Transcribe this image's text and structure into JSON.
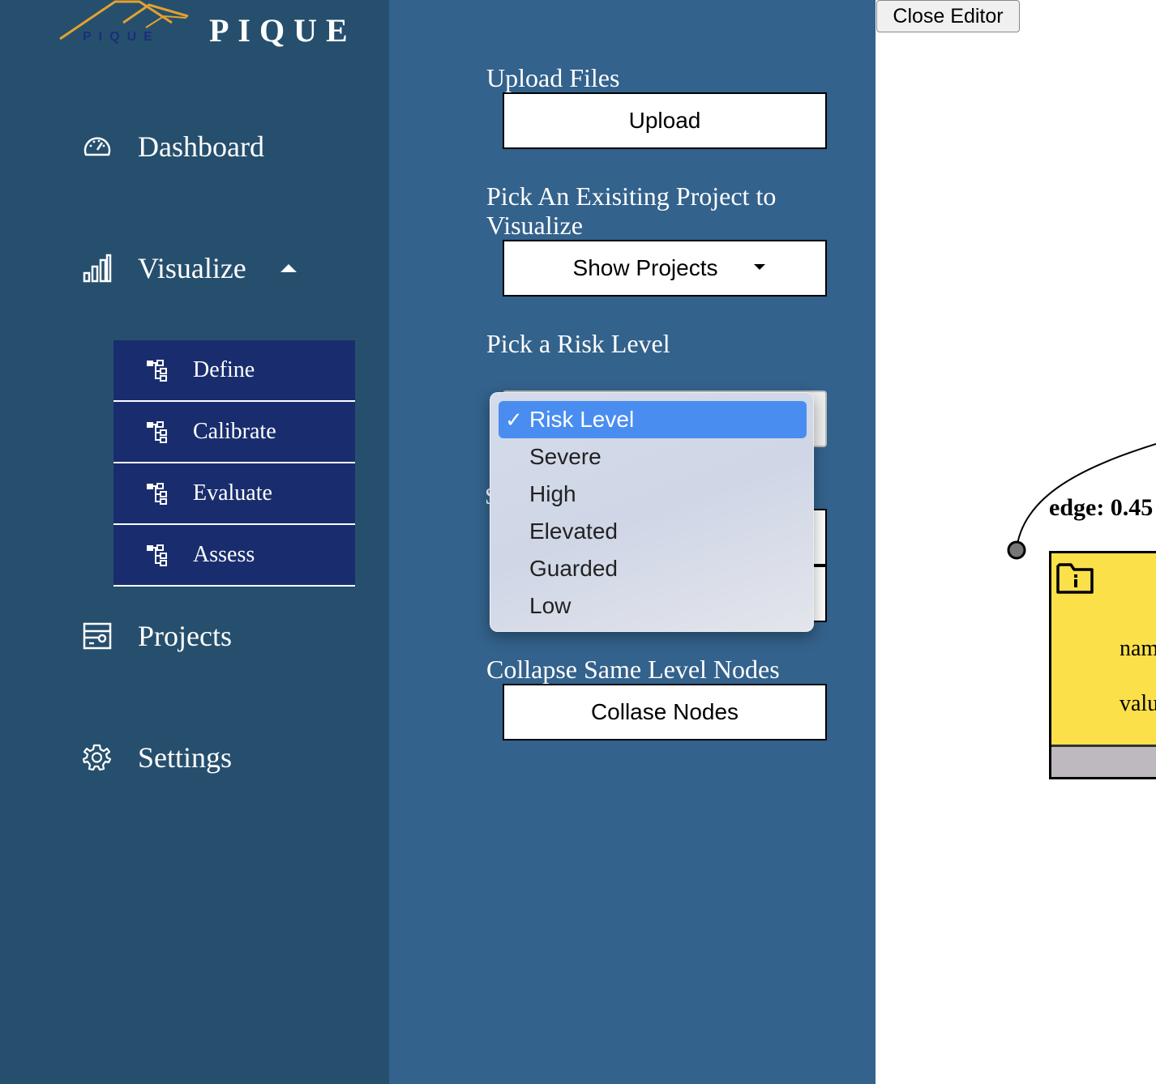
{
  "brand": {
    "name": "PIQUE",
    "logo_text": "PIQUE"
  },
  "sidebar": {
    "items": [
      {
        "label": "Dashboard",
        "icon": "gauge-icon"
      },
      {
        "label": "Visualize",
        "icon": "bar-chart-icon",
        "expanded": true
      },
      {
        "label": "Projects",
        "icon": "project-icon"
      },
      {
        "label": "Settings",
        "icon": "gear-icon"
      }
    ],
    "visualize_sub": [
      {
        "label": "Define",
        "icon": "tree-icon"
      },
      {
        "label": "Calibrate",
        "icon": "tree-icon"
      },
      {
        "label": "Evaluate",
        "icon": "tree-icon"
      },
      {
        "label": "Assess",
        "icon": "tree-icon"
      }
    ]
  },
  "editor": {
    "upload_label": "Upload Files",
    "upload_button": "Upload",
    "pick_project_label": "Pick An Exisiting Project to Visualize",
    "show_projects_button": "Show Projects",
    "risk_label": "Pick a Risk Level",
    "collapse_label": "Collapse Same Level Nodes",
    "collapse_button": "Collase Nodes",
    "hidden_letter": "S"
  },
  "risk_menu": {
    "options": [
      "Risk Level",
      "Severe",
      "High",
      "Elevated",
      "Guarded",
      "Low"
    ],
    "selected": "Risk Level",
    "check": "✓"
  },
  "canvas": {
    "close_button": "Close Editor",
    "edge_label": "edge: 0.45",
    "node": {
      "name_line": "nam",
      "value_line": "valu"
    }
  },
  "colors": {
    "sidebar": "#264f6d",
    "editor": "#33628c",
    "submenu": "#192d6e",
    "menu_highlight": "#4a8df0",
    "node_fill": "#fbe04a",
    "logo_gold": "#e3a12f"
  }
}
